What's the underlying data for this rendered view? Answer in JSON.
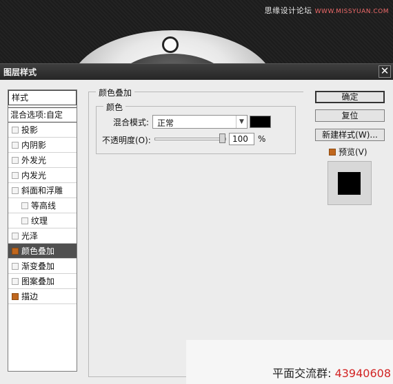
{
  "backdrop": {
    "watermark": "思缘设计论坛",
    "watermark_site": "WWW.MISSYUAN.COM"
  },
  "dialog": {
    "title": "图层样式",
    "close_label": "✕"
  },
  "left_panel": {
    "header": "样式",
    "blend_options": "混合选项:自定",
    "items": [
      {
        "label": "投影",
        "checked": false
      },
      {
        "label": "内阴影",
        "checked": false
      },
      {
        "label": "外发光",
        "checked": false
      },
      {
        "label": "内发光",
        "checked": false
      },
      {
        "label": "斜面和浮雕",
        "checked": false
      },
      {
        "label": "等高线",
        "checked": false
      },
      {
        "label": "纹理",
        "checked": false
      },
      {
        "label": "光泽",
        "checked": false
      },
      {
        "label": "颜色叠加",
        "checked": true,
        "selected": true
      },
      {
        "label": "渐变叠加",
        "checked": false
      },
      {
        "label": "图案叠加",
        "checked": false
      },
      {
        "label": "描边",
        "checked": true
      }
    ]
  },
  "color_overlay": {
    "group_title": "颜色叠加",
    "subgroup_title": "颜色",
    "blend_mode_label": "混合模式:",
    "blend_mode_value": "正常",
    "overlay_color": "#000000",
    "opacity_label": "不透明度(O):",
    "opacity_value": "100",
    "opacity_unit": "%"
  },
  "buttons": {
    "ok": "确定",
    "reset": "复位",
    "new_style": "新建样式(W)...",
    "preview": "预览(V)"
  },
  "preview_enabled": true,
  "accent_color": "#c0671e",
  "footer": {
    "label": "平面交流群:",
    "number": "43940608"
  }
}
